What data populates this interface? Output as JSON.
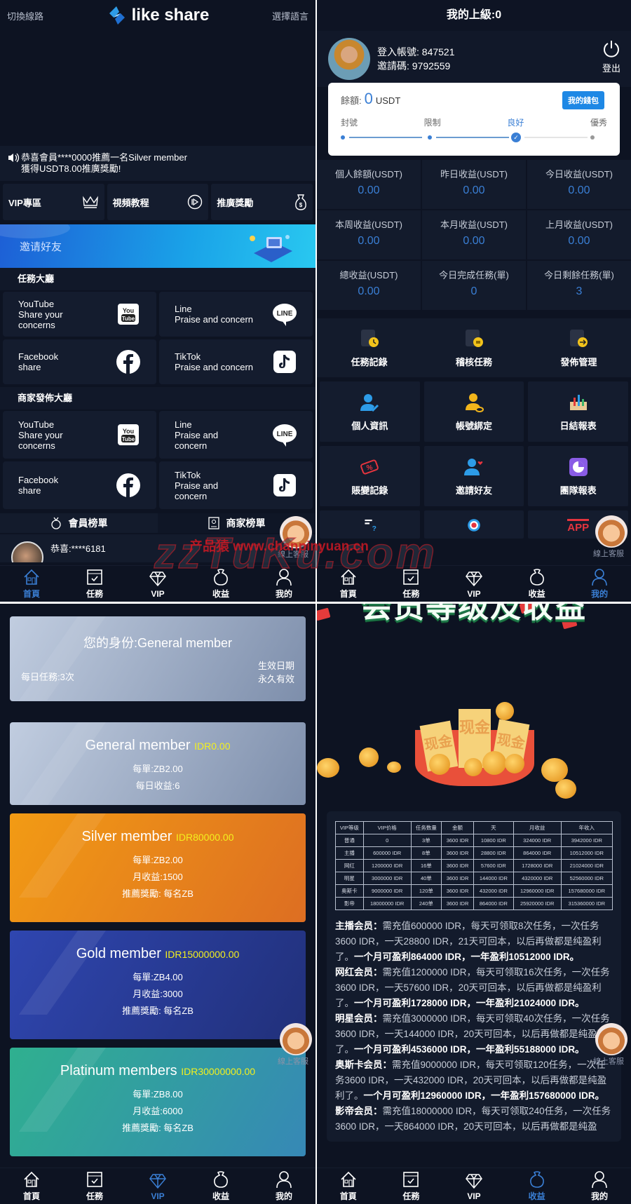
{
  "home": {
    "header": {
      "switch_route": "切換線路",
      "app_name": "like share",
      "select_language": "選擇語言"
    },
    "notice": {
      "line1": "恭喜會員****0000推薦一名Silver member",
      "line2": "獲得USDT8.00推廣獎勵!"
    },
    "quick_links": [
      {
        "label": "VIP專區",
        "icon": "crown-icon"
      },
      {
        "label": "視頻教程",
        "icon": "play-icon"
      },
      {
        "label": "推廣獎勵",
        "icon": "money-bag-icon"
      }
    ],
    "invite_banner": "邀请好友",
    "task_hall": {
      "title": "任務大廳",
      "cards": [
        {
          "title": "YouTube",
          "desc": "Share your concerns",
          "icon": "youtube-icon"
        },
        {
          "title": "Line",
          "desc": "Praise and concern",
          "icon": "line-icon"
        },
        {
          "title": "Facebook",
          "desc": "share",
          "icon": "facebook-icon"
        },
        {
          "title": "TikTok",
          "desc": "Praise and concern",
          "icon": "tiktok-icon"
        }
      ]
    },
    "merchant_hall": {
      "title": "商家發佈大廳",
      "cards": [
        {
          "title": "YouTube",
          "desc": "Share your concerns",
          "icon": "youtube-icon"
        },
        {
          "title": "Line",
          "desc": "Praise and concern",
          "icon": "line-icon"
        },
        {
          "title": "Facebook",
          "desc": "share",
          "icon": "facebook-icon"
        },
        {
          "title": "TikTok",
          "desc": "Praise and concern",
          "icon": "tiktok-icon"
        }
      ]
    },
    "rank_tabs": [
      "會員榜單",
      "商家榜單"
    ],
    "rank_item": {
      "text": "恭喜:****6181"
    }
  },
  "customer_service": "線上客服",
  "tabbar": {
    "items": [
      {
        "label": "首頁",
        "icon": "home-icon"
      },
      {
        "label": "任務",
        "icon": "task-icon"
      },
      {
        "label": "VIP",
        "icon": "diamond-icon"
      },
      {
        "label": "收益",
        "icon": "money-bag-icon"
      },
      {
        "label": "我的",
        "icon": "user-icon"
      }
    ],
    "active_by_panel": [
      "首頁",
      "我的",
      "VIP",
      "收益"
    ]
  },
  "mine": {
    "title": "我的上級:0",
    "account_label": "登入帳號:",
    "account": "847521",
    "invite_label": "邀請碼:",
    "invite_code": "9792559",
    "logout": "登出",
    "wallet": {
      "balance_label": "餘額:",
      "balance": "0",
      "unit": "USDT",
      "button": "我的錢包",
      "levels": [
        "封號",
        "限制",
        "良好",
        "優秀"
      ],
      "current_level": "良好"
    },
    "stats": [
      {
        "label": "個人餘額(USDT)",
        "value": "0.00"
      },
      {
        "label": "昨日收益(USDT)",
        "value": "0.00"
      },
      {
        "label": "今日收益(USDT)",
        "value": "0.00"
      },
      {
        "label": "本周收益(USDT)",
        "value": "0.00"
      },
      {
        "label": "本月收益(USDT)",
        "value": "0.00"
      },
      {
        "label": "上月收益(USDT)",
        "value": "0.00"
      },
      {
        "label": "總收益(USDT)",
        "value": "0.00"
      },
      {
        "label": "今日完成任務(單)",
        "value": "0"
      },
      {
        "label": "今日剩餘任務(單)",
        "value": "3"
      }
    ],
    "task_menu": [
      {
        "label": "任務記錄",
        "icon": "clock-doc-icon"
      },
      {
        "label": "稽核任務",
        "icon": "audit-doc-icon"
      },
      {
        "label": "發佈管理",
        "icon": "publish-doc-icon"
      }
    ],
    "menu": [
      {
        "label": "個人資訊",
        "icon": "user-edit-icon"
      },
      {
        "label": "帳號綁定",
        "icon": "user-link-icon"
      },
      {
        "label": "日結報表",
        "icon": "bar-report-icon"
      },
      {
        "label": "賬變記錄",
        "icon": "percent-tag-icon"
      },
      {
        "label": "邀請好友",
        "icon": "user-heart-icon"
      },
      {
        "label": "團隊報表",
        "icon": "pie-chart-icon"
      },
      {
        "label": "",
        "icon": "help-icon"
      },
      {
        "label": "",
        "icon": "badge-icon"
      },
      {
        "label": "",
        "icon": "app-icon",
        "badge_text": "APP"
      }
    ]
  },
  "vip": {
    "status": {
      "title": "您的身份:General member",
      "daily_tasks": "每日任務:3次",
      "effective_label": "生效日期",
      "effective_value": "永久有效"
    },
    "tiers": [
      {
        "name": "General member",
        "price": "IDR0.00",
        "lines": [
          "每單:ZB2.00",
          "每日收益:6"
        ]
      },
      {
        "name": "Silver member",
        "price": "IDR80000.00",
        "lines": [
          "每單:ZB2.00",
          "月收益:1500",
          "推薦獎勵: 每名ZB"
        ]
      },
      {
        "name": "Gold member",
        "price": "IDR15000000.00",
        "lines": [
          "每單:ZB4.00",
          "月收益:3000",
          "推薦獎勵: 每名ZB"
        ]
      },
      {
        "name": "Platinum members",
        "price": "IDR30000000.00",
        "lines": [
          "每單:ZB8.00",
          "月收益:6000",
          "推薦獎勵: 每名ZB"
        ]
      }
    ]
  },
  "earnings": {
    "promo_title": "会员等级及收益",
    "envelope_text": "现金",
    "table": {
      "headers": [
        "VIP等级",
        "VIP价格",
        "任务数量",
        "金额",
        "天",
        "月收益",
        "年收入"
      ],
      "rows": [
        [
          "普通",
          "0",
          "3单",
          "3600 IDR",
          "10800 IDR",
          "324000 IDR",
          "3942000 IDR"
        ],
        [
          "主播",
          "600000 IDR",
          "8单",
          "3600 IDR",
          "28800 IDR",
          "864000 IDR",
          "10512000 IDR"
        ],
        [
          "网红",
          "1200000 IDR",
          "16单",
          "3600 IDR",
          "57600 IDR",
          "1728000 IDR",
          "21024000 IDR"
        ],
        [
          "明星",
          "3000000 IDR",
          "40单",
          "3600 IDR",
          "144000 IDR",
          "4320000 IDR",
          "52560000 IDR"
        ],
        [
          "奥斯卡",
          "9000000 IDR",
          "120单",
          "3600 IDR",
          "432000 IDR",
          "12960000 IDR",
          "157680000 IDR"
        ],
        [
          "影帝",
          "18000000 IDR",
          "240单",
          "3600 IDR",
          "864000 IDR",
          "25920000 IDR",
          "315360000 IDR"
        ]
      ]
    },
    "rules": [
      {
        "name": "主播会员：",
        "text": "需充值600000 IDR，每天可领取8次任务，一次任务3600 IDR，一天28800 IDR，21天可回本，以后再做都是纯盈利了。",
        "bold": "一个月可盈利864000 IDR，一年盈利10512000 IDR。"
      },
      {
        "name": "网红会员：",
        "text": "需充值1200000 IDR，每天可领取16次任务，一次任务3600 IDR，一天57600 IDR，20天可回本，以后再做都是纯盈利了。",
        "bold": "一个月可盈利1728000 IDR，一年盈利21024000 IDR。"
      },
      {
        "name": "明星会员：",
        "text": "需充值3000000 IDR，每天可领取40次任务，一次任务3600 IDR，一天144000 IDR，20天可回本，以后再做都是纯盈利了。",
        "bold": "一个月可盈利4536000 IDR，一年盈利55188000 IDR。"
      },
      {
        "name": "奥斯卡会员：",
        "text": "需充值9000000 IDR，每天可领取120任务，一次任务3600 IDR，一天432000 IDR，20天可回本，以后再做都是纯盈利了。",
        "bold": "一个月可盈利12960000 IDR，一年盈利157680000 IDR。"
      },
      {
        "name": "影帝会员：",
        "text": "需充值18000000 IDR，每天可领取240任务，一次任务3600 IDR，一天864000 IDR，20天可回本，以后再做都是纯盈",
        "bold": ""
      }
    ]
  },
  "watermark": {
    "big": "zzTuKu.com",
    "small": "产品猿 www.chanpinyuan.cn"
  }
}
